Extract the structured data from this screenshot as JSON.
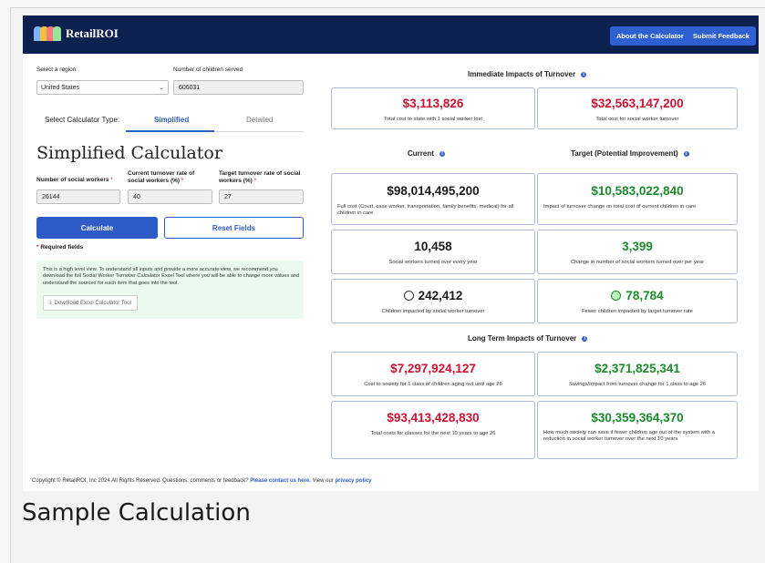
{
  "header": {
    "brand": "RetailROI",
    "about_label": "About the Calculator",
    "feedback_label": "Submit Feedback"
  },
  "form": {
    "region_label": "Select a region",
    "region_value": "United States",
    "children_label": "Number of children served",
    "children_value": "606031",
    "calc_type_label": "Select Calculator Type:",
    "tab_simplified": "Simplified",
    "tab_detailed": "Detailed",
    "title": "Simplified Calculator",
    "social_workers_label": "Number of social workers",
    "social_workers_value": "26144",
    "current_rate_label": "Current turnover rate of social workers (%)",
    "current_rate_value": "40",
    "target_rate_label": "Target turnover rate of social workers (%)",
    "target_rate_value": "27",
    "required_mark": "*",
    "calculate_label": "Calculate",
    "reset_label": "Reset Fields",
    "required_note": "Required fields",
    "info_note": "This is a high level view. To understand all inputs and provide a more accurate view, we recommend you download the full Social Worker Turnover Calculator Excel Tool where you will be able to change more values and understand the sources for each item that goes into the tool.",
    "download_label": "Download Excel Calculator Tool"
  },
  "immediate": {
    "heading": "Immediate Impacts of Turnover",
    "cards": [
      {
        "value": "$3,113,826",
        "desc": "Total cost to state with 1 social worker lost"
      },
      {
        "value": "$32,563,147,200",
        "desc": "Total cost for social worker turnover"
      }
    ]
  },
  "current": {
    "heading": "Current",
    "cards": [
      {
        "value": "$98,014,495,200",
        "desc": "Full cost (Court, case worker, transportation, family benefits, medical) for all children in care"
      },
      {
        "value": "10,458",
        "desc": "Social workers turned over every year"
      },
      {
        "value": "242,412",
        "desc": "Children impacted by social worker turnover"
      }
    ]
  },
  "target": {
    "heading": "Target (Potential Improvement)",
    "cards": [
      {
        "value": "$10,583,022,840",
        "desc": "Impact of turnover change on total cost of current children in care"
      },
      {
        "value": "3,399",
        "desc": "Change in number of social workers turned over per year"
      },
      {
        "value": "78,784",
        "desc": "Fewer children impacted by target turnover rate"
      }
    ]
  },
  "longterm": {
    "heading": "Long Term Impacts of Turnover",
    "cards": [
      {
        "value": "$7,297,924,127",
        "desc": "Cost to society for 1 class of children aging out until age 26"
      },
      {
        "value": "$2,371,825,341",
        "desc": "Savings/Impact from turnover change for 1 class to age 26"
      },
      {
        "value": "$93,413,428,830",
        "desc": "Total costs for classes for the next 10 years to age 26"
      },
      {
        "value": "$30,359,364,370",
        "desc": "How much society can save if fewer children age out of the system with a reduction in social worker turnover over the next 10 years"
      }
    ]
  },
  "footer": {
    "text": "Copyright © RetailROI, Inc 2024 All Rights Reserved. Questions, comments or feedback?",
    "contact_link": "Please contact us here.",
    "view_text": "View our",
    "privacy_link": "privacy policy"
  },
  "caption": "Sample Calculation",
  "icons": {
    "info": "info-icon",
    "sad": "sad-face-icon",
    "happy": "happy-face-icon",
    "chevron": "chevron-down-icon",
    "download": "download-icon"
  },
  "colors": {
    "nav": "#0d2150",
    "accent": "#2d5cc8",
    "negative": "#cc1230",
    "positive": "#1e8a2e"
  }
}
